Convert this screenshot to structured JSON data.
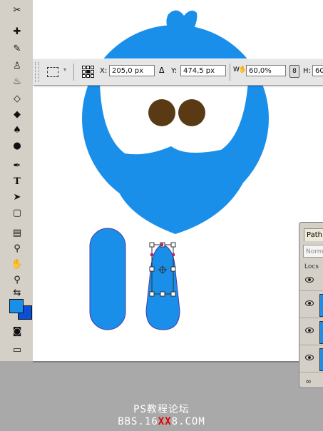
{
  "options_bar": {
    "x_label": "X:",
    "x_value": "205,0 px",
    "y_label": "Y:",
    "y_value": "474,5 px",
    "w_value": "60,0%",
    "h_label": "H:",
    "h_value": "60"
  },
  "paths_panel": {
    "tab_label": "Path",
    "blend_mode": "Norm",
    "lock_label": "Locs"
  },
  "colors": {
    "foreground": "#1a8fea",
    "background": "#0a4fd8",
    "shape_blue": "#1a8fea",
    "eye_brown": "#5a3a14"
  },
  "watermark": {
    "line1": "PS教程论坛",
    "line2_prefix": "BBS.16",
    "line2_red": "XX",
    "line2_suffix": "8.COM"
  }
}
